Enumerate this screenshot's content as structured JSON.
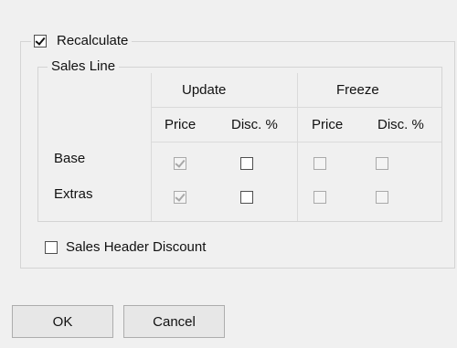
{
  "recalculate": {
    "label": "Recalculate",
    "checked": true
  },
  "sales_line": {
    "title": "Sales Line",
    "groups": [
      "Update",
      "Freeze"
    ],
    "columns": [
      "Price",
      "Disc. %",
      "Price",
      "Disc. %"
    ],
    "rows": [
      {
        "label": "Base",
        "cells": [
          true,
          false,
          false,
          false
        ]
      },
      {
        "label": "Extras",
        "cells": [
          true,
          false,
          false,
          false
        ]
      }
    ]
  },
  "sales_header_discount": {
    "label": "Sales Header Discount",
    "checked": false
  },
  "buttons": {
    "ok": "OK",
    "cancel": "Cancel"
  }
}
